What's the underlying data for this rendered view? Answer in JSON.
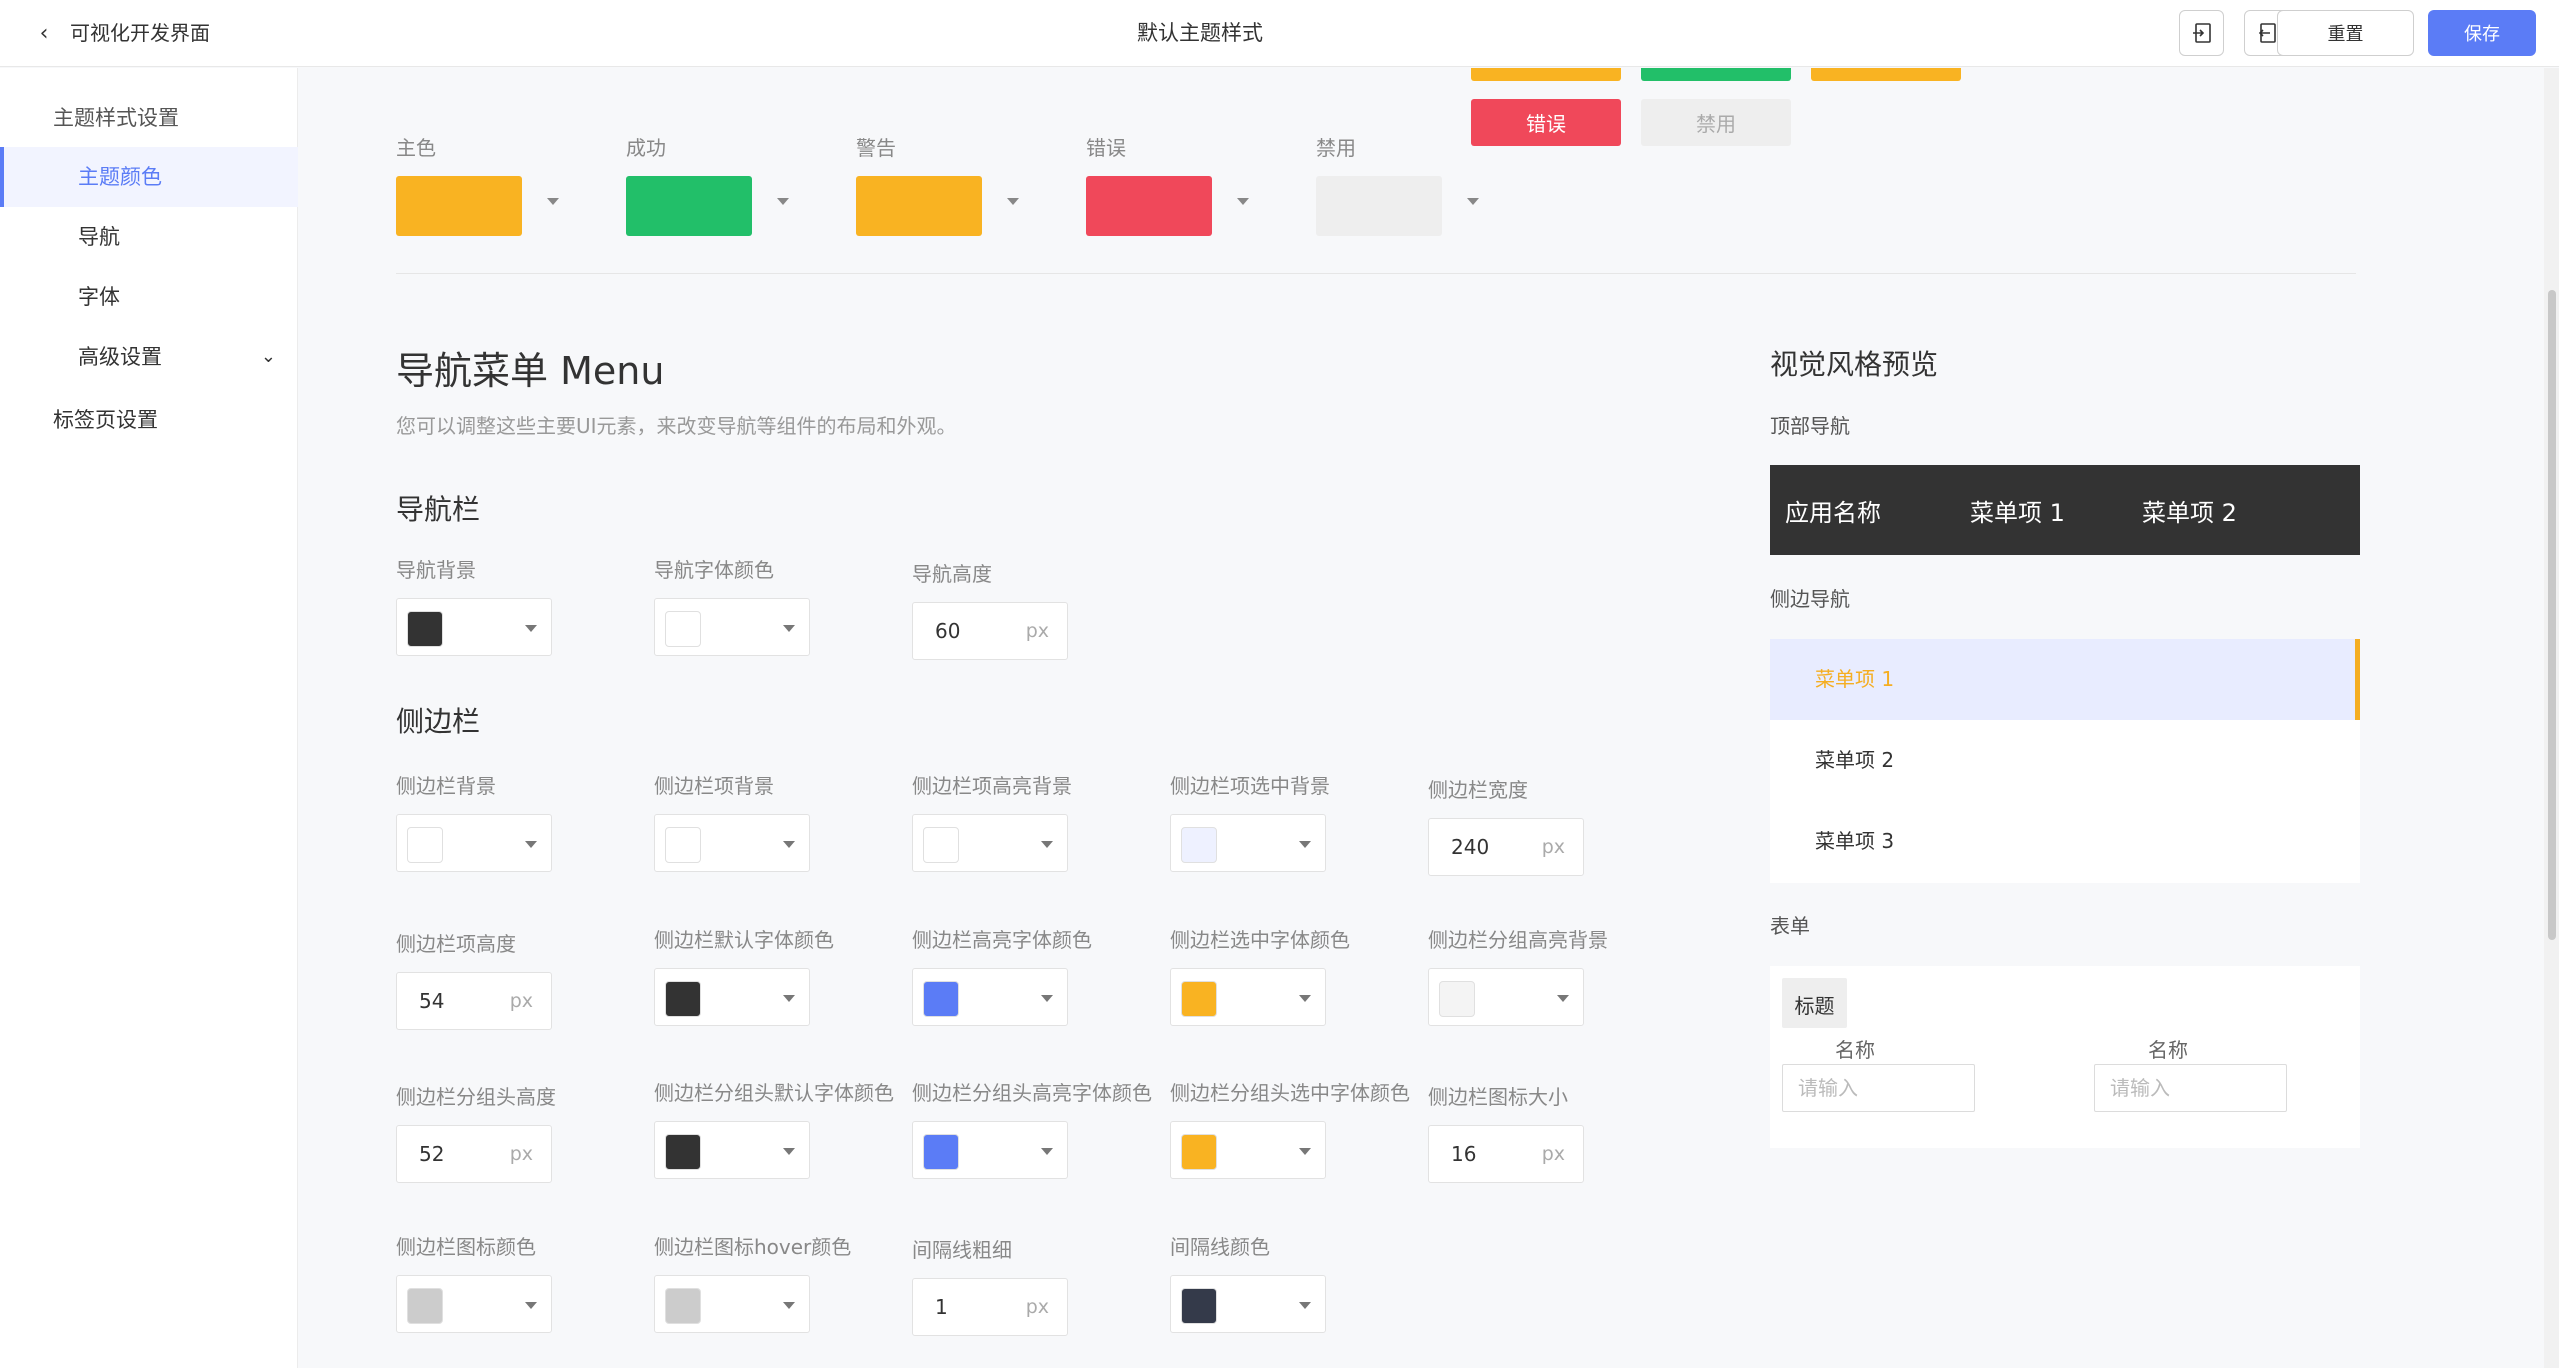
{
  "header": {
    "app_title": "可视化开发界面",
    "page_title": "默认主题样式",
    "reset_label": "重置",
    "save_label": "保存"
  },
  "sidebar": {
    "group_theme": "主题样式设置",
    "items": [
      {
        "label": "主题颜色",
        "active": true
      },
      {
        "label": "导航"
      },
      {
        "label": "字体"
      },
      {
        "label": "高级设置"
      }
    ],
    "group_tabs": "标签页设置"
  },
  "theme_colors": [
    {
      "label": "主色",
      "color": "#f9b322"
    },
    {
      "label": "成功",
      "color": "#22bf69"
    },
    {
      "label": "警告",
      "color": "#f9b322"
    },
    {
      "label": "错误",
      "color": "#f0485a"
    },
    {
      "label": "禁用",
      "color": "#eeeeee"
    }
  ],
  "menu_section": {
    "title": "导航菜单 Menu",
    "description": "您可以调整这些主要UI元素，来改变导航等组件的布局和外观。",
    "navbar_title": "导航栏",
    "navbar": {
      "bg_label": "导航背景",
      "bg_color": "#333333",
      "font_color_label": "导航字体颜色",
      "font_color": "#ffffff",
      "height_label": "导航高度",
      "height_value": "60",
      "unit": "px"
    },
    "sidebar_title": "侧边栏",
    "sidebar_fields": {
      "bg_label": "侧边栏背景",
      "bg_color": "#ffffff",
      "item_bg_label": "侧边栏项背景",
      "item_bg_color": "#ffffff",
      "item_hl_bg_label": "侧边栏项高亮背景",
      "item_hl_bg_color": "#ffffff",
      "item_sel_bg_label": "侧边栏项选中背景",
      "item_sel_bg_color": "#eef1ff",
      "width_label": "侧边栏宽度",
      "width_value": "240",
      "item_height_label": "侧边栏项高度",
      "item_height_value": "54",
      "default_font_label": "侧边栏默认字体颜色",
      "default_font_color": "#333333",
      "hl_font_label": "侧边栏高亮字体颜色",
      "hl_font_color": "#5b7cf6",
      "sel_font_label": "侧边栏选中字体颜色",
      "sel_font_color": "#f9b322",
      "group_hl_bg_label": "侧边栏分组高亮背景",
      "group_hl_bg_color": "#f4f4f4",
      "group_head_height_label": "侧边栏分组头高度",
      "group_head_height_value": "52",
      "group_head_default_font_label": "侧边栏分组头默认字体颜色",
      "group_head_default_font_color": "#333333",
      "group_head_hl_font_label": "侧边栏分组头高亮字体颜色",
      "group_head_hl_font_color": "#5b7cf6",
      "group_head_sel_font_label": "侧边栏分组头选中字体颜色",
      "group_head_sel_font_color": "#f9b322",
      "icon_size_label": "侧边栏图标大小",
      "icon_size_value": "16",
      "icon_color_label": "侧边栏图标颜色",
      "icon_color": "#cccccc",
      "icon_hover_label": "侧边栏图标hover颜色",
      "icon_hover_color": "#cccccc",
      "divider_width_label": "间隔线粗细",
      "divider_width_value": "1",
      "divider_color_label": "间隔线颜色",
      "divider_color": "#343a4a",
      "unit": "px"
    }
  },
  "preview": {
    "error_btn": "错误",
    "disabled_btn": "禁用",
    "title": "视觉风格预览",
    "topnav_label": "顶部导航",
    "topnav": {
      "app_name": "应用名称",
      "item1": "菜单项 1",
      "item2": "菜单项 2"
    },
    "sidenav_label": "侧边导航",
    "sidenav_items": [
      "菜单项 1",
      "菜单项 2",
      "菜单项 3"
    ],
    "form_label": "表单",
    "form": {
      "title": "标题",
      "field1_label": "名称",
      "field1_placeholder": "请输入",
      "field2_label": "名称",
      "field2_placeholder": "请输入"
    },
    "colors": {
      "primary": "#f9b322",
      "success": "#22bf69",
      "error": "#f0485a",
      "disabled": "#eeeeee"
    }
  }
}
